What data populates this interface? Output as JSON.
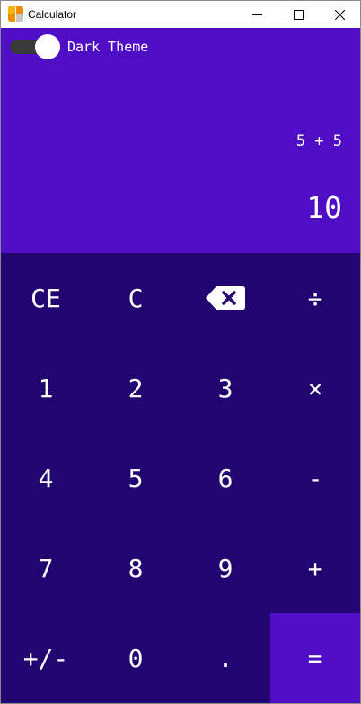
{
  "window": {
    "title": "Calculator",
    "icon": "calculator-app-icon",
    "controls": [
      "minimize-icon",
      "maximize-icon",
      "close-icon"
    ]
  },
  "theme_toggle": {
    "label": "Dark Theme",
    "on": true
  },
  "display": {
    "expression": "5 + 5",
    "result": "10"
  },
  "keypad": {
    "rows": [
      [
        "CE",
        "C",
        "backspace-icon",
        "÷"
      ],
      [
        "1",
        "2",
        "3",
        "×"
      ],
      [
        "4",
        "5",
        "6",
        "-"
      ],
      [
        "7",
        "8",
        "9",
        "+"
      ],
      [
        "+/-",
        "0",
        ".",
        "="
      ]
    ],
    "keys": {
      "ce": "CE",
      "c": "C",
      "divide": "÷",
      "one": "1",
      "two": "2",
      "three": "3",
      "multiply": "×",
      "four": "4",
      "five": "5",
      "six": "6",
      "minus": "-",
      "seven": "7",
      "eight": "8",
      "nine": "9",
      "plus": "+",
      "negate": "+/-",
      "zero": "0",
      "decimal": ".",
      "equals": "="
    }
  },
  "colors": {
    "display_bg": "#4f0ec5",
    "keypad_bg": "#230571",
    "equals_bg": "#4f0ec5",
    "text": "#ffffff",
    "toggle_track": "#3a3a3a"
  }
}
